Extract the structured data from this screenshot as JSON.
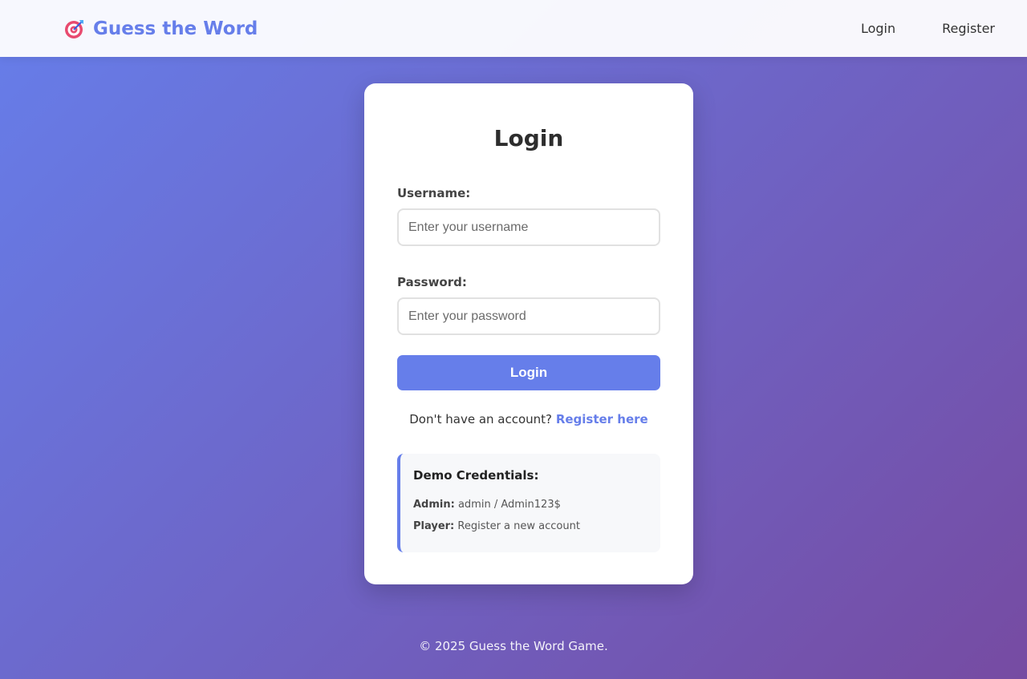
{
  "nav": {
    "brand_icon": "target-icon",
    "brand_title": "Guess the Word",
    "links": [
      "Login",
      "Register"
    ]
  },
  "login_card": {
    "title": "Login",
    "username_label": "Username:",
    "username_placeholder": "Enter your username",
    "username_value": "",
    "password_label": "Password:",
    "password_placeholder": "Enter your password",
    "password_value": "",
    "submit_label": "Login",
    "register_prompt": "Don't have an account?",
    "register_link": "Register here"
  },
  "demo": {
    "title": "Demo Credentials:",
    "admin_label": "Admin:",
    "admin_value": "admin / Admin123$",
    "player_label": "Player:",
    "player_value": "Register a new account"
  },
  "footer": {
    "text": "© 2025 Guess the Word Game."
  },
  "colors": {
    "accent": "#667eea",
    "gradient_start": "#667eea",
    "gradient_end": "#764ba2"
  }
}
